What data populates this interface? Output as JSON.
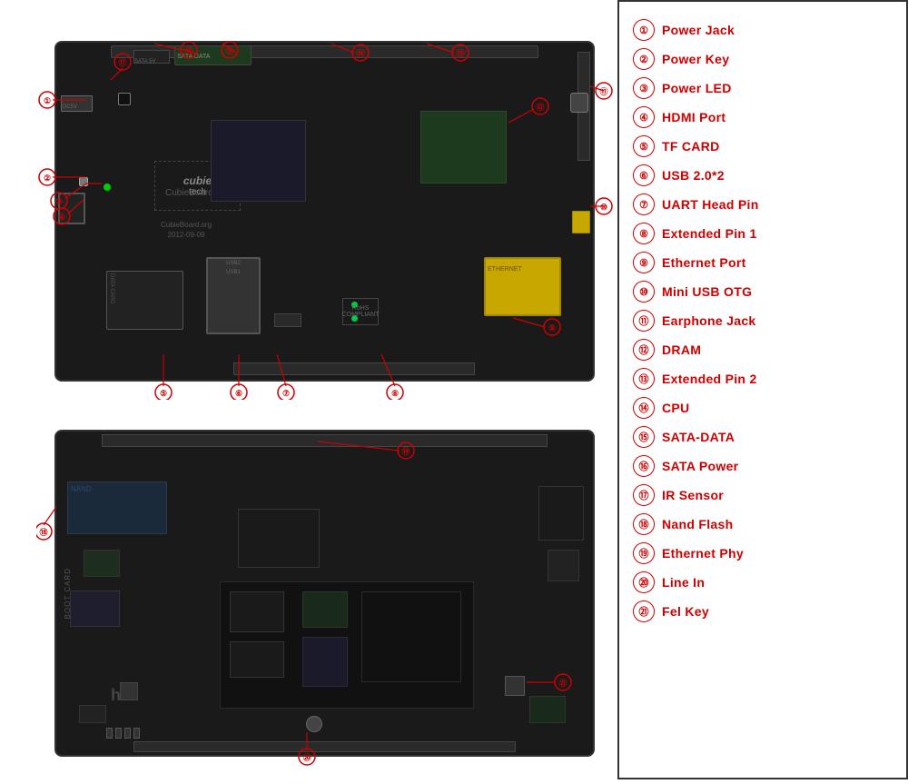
{
  "legend": {
    "items": [
      {
        "num": "①",
        "label": "Power Jack"
      },
      {
        "num": "②",
        "label": "Power Key"
      },
      {
        "num": "③",
        "label": "Power LED"
      },
      {
        "num": "④",
        "label": "HDMI Port"
      },
      {
        "num": "⑤",
        "label": "TF CARD"
      },
      {
        "num": "⑥",
        "label": "USB 2.0*2"
      },
      {
        "num": "⑦",
        "label": "UART Head Pin"
      },
      {
        "num": "⑧",
        "label": "Extended Pin 1"
      },
      {
        "num": "⑨",
        "label": "Ethernet Port"
      },
      {
        "num": "⑩",
        "label": "Mini USB OTG"
      },
      {
        "num": "⑪",
        "label": "Earphone Jack"
      },
      {
        "num": "⑫",
        "label": "DRAM"
      },
      {
        "num": "⑬",
        "label": "Extended Pin 2"
      },
      {
        "num": "⑭",
        "label": "CPU"
      },
      {
        "num": "⑮",
        "label": "SATA-DATA"
      },
      {
        "num": "⑯",
        "label": "SATA  Power"
      },
      {
        "num": "⑰",
        "label": "IR  Sensor"
      },
      {
        "num": "⑱",
        "label": "Nand Flash"
      },
      {
        "num": "⑲",
        "label": "Ethernet Phy"
      },
      {
        "num": "⑳",
        "label": "Line In"
      },
      {
        "num": "㉑",
        "label": "Fel Key"
      }
    ]
  },
  "board": {
    "top_label": "CubieBoard.org\n2012-09-09",
    "cubie_text": "cubie\ntech",
    "sata_label": "SATA DATA",
    "sata_power": "SATA 5V",
    "usb_label": "USB2\nUSB1",
    "datacard": "DATA CARD",
    "rohs": "RoHS",
    "boot_card": "BOOT\nCARD"
  },
  "colors": {
    "red": "#cc0000",
    "board_bg": "#111111",
    "board_border": "#333333",
    "accent_gold": "#c8a800",
    "white": "#ffffff"
  }
}
